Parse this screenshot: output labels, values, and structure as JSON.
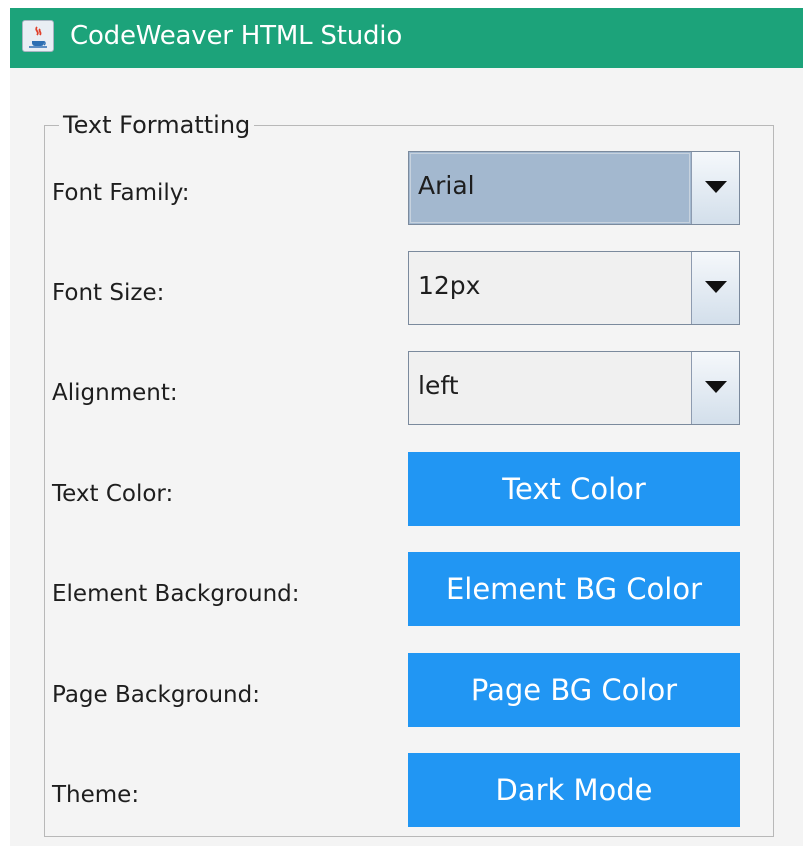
{
  "window": {
    "title": "CodeWeaver HTML Studio",
    "icon": "java-coffee-icon",
    "titlebar_color": "#1ca37a"
  },
  "text_formatting": {
    "legend": "Text Formatting",
    "font_family": {
      "label": "Font Family:",
      "value": "Arial"
    },
    "font_size": {
      "label": "Font Size:",
      "value": "12px"
    },
    "alignment": {
      "label": "Alignment:",
      "value": "left"
    },
    "text_color": {
      "label": "Text Color:",
      "button": "Text Color"
    },
    "element_background": {
      "label": "Element Background:",
      "button": "Element BG Color"
    },
    "page_background": {
      "label": "Page Background:",
      "button": "Page BG Color"
    },
    "theme": {
      "label": "Theme:",
      "button": "Dark Mode"
    },
    "button_color": "#2196f3"
  }
}
